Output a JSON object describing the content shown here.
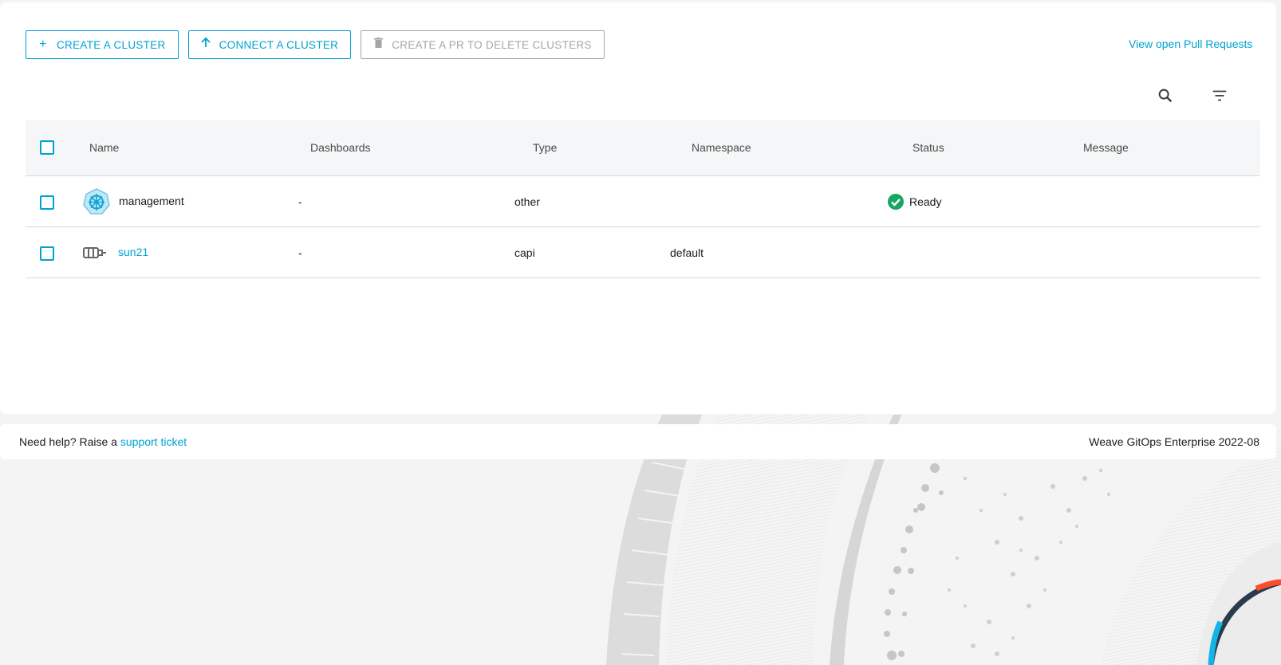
{
  "toolbar": {
    "create_cluster": "CREATE A CLUSTER",
    "connect_cluster": "CONNECT A CLUSTER",
    "delete_clusters": "CREATE A PR TO DELETE CLUSTERS",
    "view_prs": "View open Pull Requests"
  },
  "table": {
    "columns": [
      "Name",
      "Dashboards",
      "Type",
      "Namespace",
      "Status",
      "Message"
    ],
    "rows": [
      {
        "icon": "kubernetes-icon",
        "name": "management",
        "name_is_link": false,
        "dashboards": "-",
        "type": "other",
        "namespace": "",
        "status": "Ready",
        "message": ""
      },
      {
        "icon": "capi-cluster-icon",
        "name": "sun21",
        "name_is_link": true,
        "dashboards": "-",
        "type": "capi",
        "namespace": "default",
        "status": "",
        "message": ""
      }
    ]
  },
  "footer": {
    "help_prefix": "Need help? Raise a",
    "support_link": "support ticket",
    "version": "Weave GitOps Enterprise 2022-08"
  },
  "colors": {
    "accent": "#00a2d2",
    "ready_green": "#17a563",
    "disabled": "#a6a6a6"
  }
}
